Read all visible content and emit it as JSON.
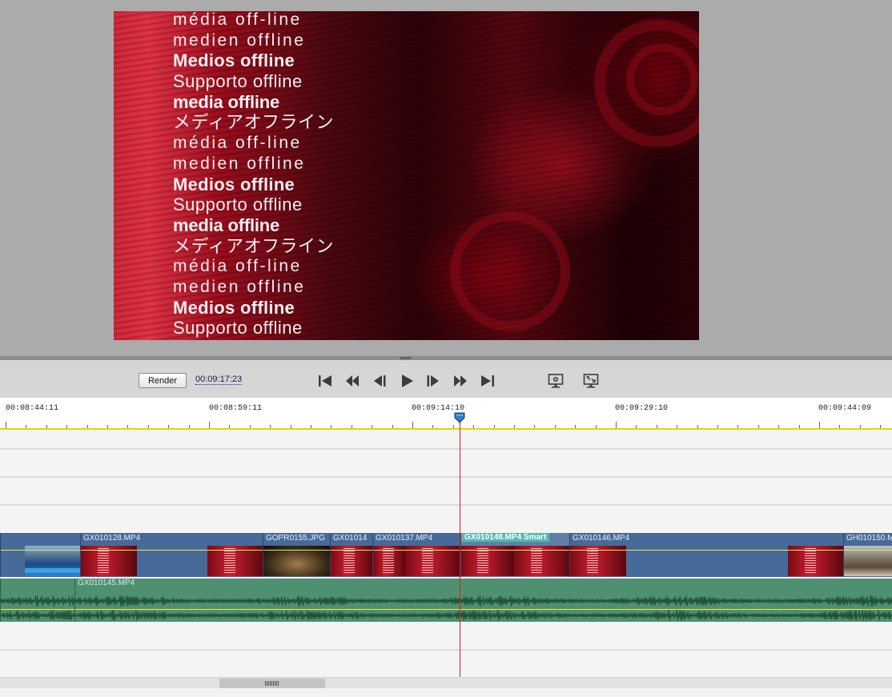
{
  "preview": {
    "offline_lines": [
      {
        "text": "média off-line",
        "style": "wide"
      },
      {
        "text": "medien offline",
        "style": "wide"
      },
      {
        "text": "Medios offline",
        "style": "bold"
      },
      {
        "text": "Supporto offline",
        "style": "normal"
      },
      {
        "text": "media offline",
        "style": "heavy"
      },
      {
        "text": "メディアオフライン",
        "style": "normal"
      },
      {
        "text": "média off-line",
        "style": "wide"
      },
      {
        "text": "medien offline",
        "style": "wide"
      },
      {
        "text": "Medios offline",
        "style": "bold"
      },
      {
        "text": "Supporto offline",
        "style": "normal"
      },
      {
        "text": "media offline",
        "style": "heavy"
      },
      {
        "text": "メディアオフライン",
        "style": "normal"
      },
      {
        "text": "média off-line",
        "style": "wide"
      },
      {
        "text": "medien offline",
        "style": "wide"
      },
      {
        "text": "Medios offline",
        "style": "bold"
      },
      {
        "text": "Supporto offline",
        "style": "normal"
      }
    ]
  },
  "transport": {
    "render_label": "Render",
    "timecode": "00:09:17:23"
  },
  "ruler": {
    "labels": [
      "00:08:44:11",
      "00:08:59:11",
      "00:09:14:10",
      "00:09:29:10",
      "00:09:44:09"
    ]
  },
  "video_clips": [
    {
      "name": "",
      "thumb": "pool"
    },
    {
      "name": "GX010128.MP4",
      "thumb": "red"
    },
    {
      "name": "GOPR0155.JPG",
      "thumb": "dark"
    },
    {
      "name": "GX01014",
      "thumb": "red"
    },
    {
      "name": "GX010137.MP4",
      "thumb": "red"
    },
    {
      "name": "GX010148.MP4 Smart",
      "thumb": "red",
      "selected": true
    },
    {
      "name": "GX010146.MP4",
      "thumb": "red"
    },
    {
      "name": "GH010150.M",
      "thumb": "crowd"
    }
  ],
  "audio_clips": [
    {
      "name": ""
    },
    {
      "name": "GX010145.MP4"
    }
  ],
  "colors": {
    "playhead": "#d81e1e",
    "video_track": "#476a99",
    "audio_track": "#4e9070",
    "selected_clip_label": "#56b8b0",
    "ruler_underline": "#e6d600"
  }
}
